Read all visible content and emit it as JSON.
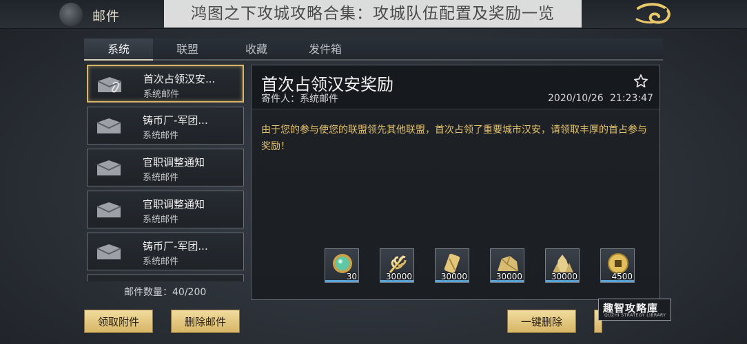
{
  "overlay_caption": "鸿图之下攻城攻略合集：攻城队伍配置及奖励一览",
  "header": {
    "title": "邮件"
  },
  "tabs": [
    {
      "label": "系统",
      "active": true
    },
    {
      "label": "联盟",
      "active": false
    },
    {
      "label": "收藏",
      "active": false
    },
    {
      "label": "发件箱",
      "active": false
    }
  ],
  "mail_list": [
    {
      "title": "首次占领汉安...",
      "subtitle": "系统邮件",
      "selected": true,
      "has_attachment": true
    },
    {
      "title": "铸币厂-军团...",
      "subtitle": "系统邮件",
      "selected": false
    },
    {
      "title": "官职调整通知",
      "subtitle": "系统邮件",
      "selected": false
    },
    {
      "title": "官职调整通知",
      "subtitle": "系统邮件",
      "selected": false
    },
    {
      "title": "铸币厂-军团...",
      "subtitle": "系统邮件",
      "selected": false
    }
  ],
  "mail_count": "邮件数量：40/200",
  "detail": {
    "title": "首次占领汉安奖励",
    "sender": "寄件人：系统邮件",
    "date": "2020/10/26",
    "time": "21:23:47",
    "body": "由于您的参与使您的联盟领先其他联盟，首次占领了重要城市汉安，请领取丰厚的首占参与奖励！"
  },
  "rewards": [
    {
      "icon": "jade-orb-icon",
      "qty": "30"
    },
    {
      "icon": "grain-icon",
      "qty": "30000"
    },
    {
      "icon": "wood-icon",
      "qty": "30000"
    },
    {
      "icon": "stone-icon",
      "qty": "30000"
    },
    {
      "icon": "iron-ore-icon",
      "qty": "30000"
    },
    {
      "icon": "copper-coin-icon",
      "qty": "4500"
    }
  ],
  "buttons": {
    "claim_attachments": "领取附件",
    "delete_mail": "删除邮件",
    "delete_all": "一键删除"
  },
  "watermark": {
    "main": "趣智攻略庫",
    "sub": "QUZHI STRATEGY LIBRARY"
  },
  "colors": {
    "accent_gold": "#d7b566",
    "body_text": "#e6c36d",
    "selected_border": "#d7b56a"
  }
}
